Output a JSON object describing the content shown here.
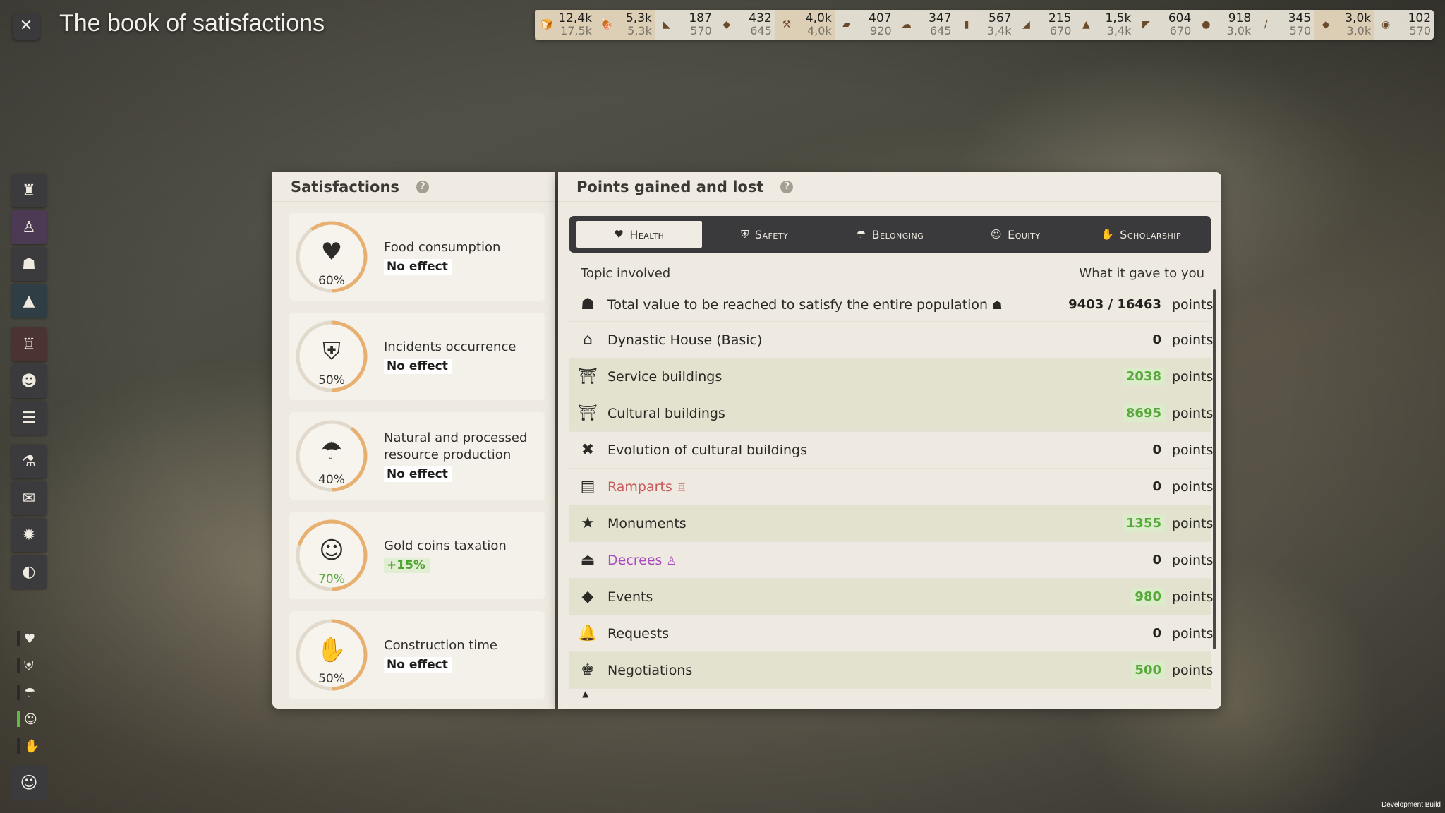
{
  "window": {
    "title": "The book of satisfactions",
    "close_icon": "✕",
    "footer": "Development Build"
  },
  "resources": [
    {
      "icon": "bread-icon",
      "glyph": "🍞",
      "current": "12,4k",
      "max": "17,5k",
      "highlight": true
    },
    {
      "icon": "meat-icon",
      "glyph": "🍖",
      "current": "5,3k",
      "max": "5,3k",
      "highlight": true
    },
    {
      "icon": "leather-icon",
      "glyph": "◣",
      "current": "187",
      "max": "570",
      "highlight": false
    },
    {
      "icon": "fish-icon",
      "glyph": "◆",
      "current": "432",
      "max": "645",
      "highlight": false
    },
    {
      "icon": "worker-icon",
      "glyph": "⚒",
      "current": "4,0k",
      "max": "4,0k",
      "highlight": true
    },
    {
      "icon": "iron-icon",
      "glyph": "▰",
      "current": "407",
      "max": "920",
      "highlight": false
    },
    {
      "icon": "salt-icon",
      "glyph": "☁",
      "current": "347",
      "max": "645",
      "highlight": false
    },
    {
      "icon": "wood-icon",
      "glyph": "▮",
      "current": "567",
      "max": "3,4k",
      "highlight": false
    },
    {
      "icon": "brick-icon",
      "glyph": "◢",
      "current": "215",
      "max": "670",
      "highlight": false
    },
    {
      "icon": "grain-icon",
      "glyph": "▲",
      "current": "1,5k",
      "max": "3,4k",
      "highlight": false
    },
    {
      "icon": "tool-icon",
      "glyph": "◤",
      "current": "604",
      "max": "670",
      "highlight": false
    },
    {
      "icon": "stone-icon",
      "glyph": "●",
      "current": "918",
      "max": "3,0k",
      "highlight": false
    },
    {
      "icon": "sword-icon",
      "glyph": "/",
      "current": "345",
      "max": "570",
      "highlight": false
    },
    {
      "icon": "cheese-icon",
      "glyph": "◆",
      "current": "3,0k",
      "max": "3,0k",
      "highlight": true
    },
    {
      "icon": "gold-icon",
      "glyph": "◉",
      "current": "102",
      "max": "570",
      "highlight": false
    }
  ],
  "toolbar_icons": [
    {
      "name": "settlement-icon",
      "glyph": "♜",
      "style": "",
      "dot": false
    },
    {
      "name": "decree-icon",
      "glyph": "♙",
      "style": "purple",
      "dot": false
    },
    {
      "name": "population-icon",
      "glyph": "☗",
      "style": "",
      "dot": false
    },
    {
      "name": "scholarship-icon",
      "glyph": "▲",
      "style": "teal",
      "dot": false
    },
    {
      "name": "trophy-icon",
      "glyph": "♖",
      "style": "red",
      "dot": false
    },
    {
      "name": "family-icon",
      "glyph": "☻",
      "style": "",
      "dot": true
    },
    {
      "name": "list-icon",
      "glyph": "☰",
      "style": "",
      "dot": false
    },
    {
      "name": "potion-icon",
      "glyph": "⚗",
      "style": "",
      "dot": false
    },
    {
      "name": "mail-icon",
      "glyph": "✉",
      "style": "",
      "dot": true
    },
    {
      "name": "settings-icon",
      "glyph": "✹",
      "style": "",
      "dot": false
    },
    {
      "name": "globe-icon",
      "glyph": "◐",
      "style": "",
      "dot": false
    }
  ],
  "mini_toolbar": [
    {
      "name": "health-mini-icon",
      "glyph": "♥",
      "green": false
    },
    {
      "name": "safety-mini-icon",
      "glyph": "⛨",
      "green": false
    },
    {
      "name": "belonging-mini-icon",
      "glyph": "☂",
      "green": false
    },
    {
      "name": "equity-mini-icon",
      "glyph": "☺",
      "green": true
    },
    {
      "name": "scholarship-mini-icon",
      "glyph": "✋",
      "green": false
    }
  ],
  "bottom_tool_icon": "people-group-icon",
  "satisfactions": {
    "title": "Satisfactions",
    "help": "?",
    "items": [
      {
        "label": "Food consumption",
        "effect": "No effect",
        "percent": "60%",
        "value": 0.6,
        "icon": "heartbeat-icon",
        "glyph": "♥",
        "positive": false
      },
      {
        "label": "Incidents occurrence",
        "effect": "No effect",
        "percent": "50%",
        "value": 0.5,
        "icon": "shield-icon",
        "glyph": "⛨",
        "positive": false
      },
      {
        "label": "Natural and processed resource production",
        "effect": "No effect",
        "percent": "40%",
        "value": 0.4,
        "icon": "hand-resource-icon",
        "glyph": "☂",
        "positive": false
      },
      {
        "label": "Gold coins taxation",
        "effect": "+15%",
        "percent": "70%",
        "value": 0.7,
        "icon": "coin-hand-icon",
        "glyph": "☺",
        "positive": true
      },
      {
        "label": "Construction time",
        "effect": "No effect",
        "percent": "50%",
        "value": 0.5,
        "icon": "builder-icon",
        "glyph": "✋",
        "positive": false
      }
    ]
  },
  "points": {
    "title": "Points gained and lost",
    "help": "?",
    "tabs": [
      {
        "label": "Health",
        "icon": "heart-icon",
        "glyph": "♥",
        "active": true
      },
      {
        "label": "Safety",
        "icon": "shield-icon",
        "glyph": "⛨",
        "active": false
      },
      {
        "label": "Belonging",
        "icon": "belonging-icon",
        "glyph": "☂",
        "active": false
      },
      {
        "label": "Equity",
        "icon": "equity-icon",
        "glyph": "☺",
        "active": false
      },
      {
        "label": "Scholarship",
        "icon": "scholarship-icon",
        "glyph": "✋",
        "active": false
      }
    ],
    "col_topic": "Topic involved",
    "col_value": "What it gave to you",
    "rows": [
      {
        "label": "Total value to be reached to satisfy the entire population",
        "suffix": "☗",
        "suffix_style": "",
        "value": "9403 / 16463",
        "unit": "points",
        "icon": "population-icon",
        "glyph": "☗",
        "label_style": "",
        "value_style": "",
        "shaded": false
      },
      {
        "label": "Dynastic House (Basic)",
        "suffix": "",
        "suffix_style": "",
        "value": "0",
        "unit": "points",
        "icon": "house-icon",
        "glyph": "⌂",
        "label_style": "",
        "value_style": "",
        "shaded": false
      },
      {
        "label": "Service buildings",
        "suffix": "",
        "suffix_style": "",
        "value": "2038",
        "unit": "points",
        "icon": "service-building-icon",
        "glyph": "⛩",
        "label_style": "",
        "value_style": "green",
        "shaded": true
      },
      {
        "label": "Cultural buildings",
        "suffix": "",
        "suffix_style": "",
        "value": "8695",
        "unit": "points",
        "icon": "cultural-building-icon",
        "glyph": "⛩",
        "label_style": "",
        "value_style": "green",
        "shaded": true
      },
      {
        "label": "Evolution of cultural buildings",
        "suffix": "",
        "suffix_style": "",
        "value": "0",
        "unit": "points",
        "icon": "tools-icon",
        "glyph": "✖",
        "label_style": "",
        "value_style": "",
        "shaded": false
      },
      {
        "label": "Ramparts",
        "suffix": "♖",
        "suffix_style": "red",
        "value": "0",
        "unit": "points",
        "icon": "ramparts-icon",
        "glyph": "▤",
        "label_style": "red",
        "value_style": "",
        "shaded": false
      },
      {
        "label": "Monuments",
        "suffix": "",
        "suffix_style": "",
        "value": "1355",
        "unit": "points",
        "icon": "monument-icon",
        "glyph": "★",
        "label_style": "",
        "value_style": "green",
        "shaded": true
      },
      {
        "label": "Decrees",
        "suffix": "♙",
        "suffix_style": "purple",
        "value": "0",
        "unit": "points",
        "icon": "decree-icon",
        "glyph": "⏏",
        "label_style": "purple",
        "value_style": "",
        "shaded": false
      },
      {
        "label": "Events",
        "suffix": "",
        "suffix_style": "",
        "value": "980",
        "unit": "points",
        "icon": "event-icon",
        "glyph": "◆",
        "label_style": "",
        "value_style": "green",
        "shaded": true
      },
      {
        "label": "Requests",
        "suffix": "",
        "suffix_style": "",
        "value": "0",
        "unit": "points",
        "icon": "bell-icon",
        "glyph": "🔔",
        "label_style": "",
        "value_style": "",
        "shaded": false
      },
      {
        "label": "Negotiations",
        "suffix": "",
        "suffix_style": "",
        "value": "500",
        "unit": "points",
        "icon": "negotiation-icon",
        "glyph": "♚",
        "label_style": "",
        "value_style": "green",
        "shaded": true
      }
    ]
  },
  "colors": {
    "accent_green": "#59a83c",
    "ring_orange": "#e8b070",
    "ring_track": "#e1d9cb",
    "panel_bg": "#eeeae2",
    "tab_dark": "#3a3a3c"
  }
}
